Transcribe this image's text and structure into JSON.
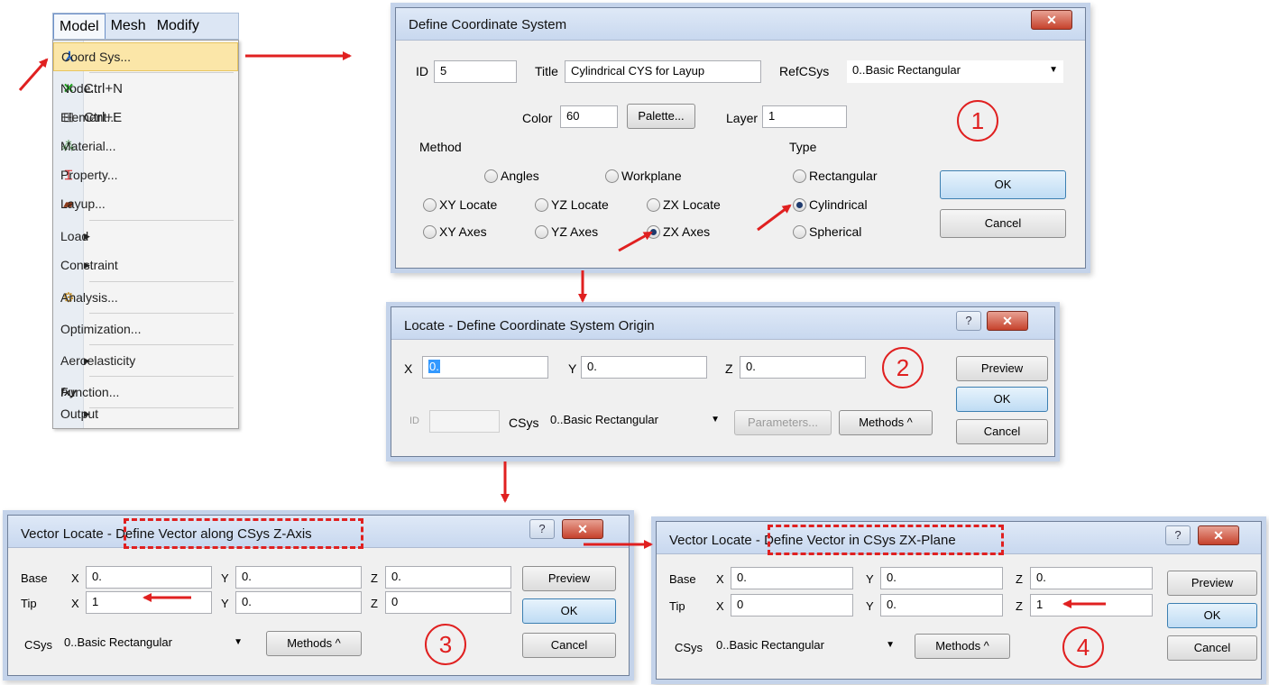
{
  "menubar": {
    "items": [
      "Model",
      "Mesh",
      "Modify"
    ]
  },
  "menu": {
    "items": [
      {
        "label": "Coord Sys...",
        "shortcut": "",
        "submenu": false,
        "icon": "⅄"
      },
      {
        "label": "Node...",
        "shortcut": "Ctrl+N",
        "submenu": false,
        "icon": "✕"
      },
      {
        "label": "Element...",
        "shortcut": "Ctrl+E",
        "submenu": false,
        "icon": "⊞"
      },
      {
        "label": "Material...",
        "shortcut": "",
        "submenu": false,
        "icon": "⁂"
      },
      {
        "label": "Property...",
        "shortcut": "",
        "submenu": false,
        "icon": "⌶"
      },
      {
        "label": "Layup...",
        "shortcut": "",
        "submenu": false,
        "icon": "▰"
      },
      {
        "label": "Load",
        "shortcut": "",
        "submenu": true,
        "icon": ""
      },
      {
        "label": "Constraint",
        "shortcut": "",
        "submenu": true,
        "icon": ""
      },
      {
        "label": "Analysis...",
        "shortcut": "",
        "submenu": false,
        "icon": "⚙"
      },
      {
        "label": "Optimization...",
        "shortcut": "",
        "submenu": false,
        "icon": ""
      },
      {
        "label": "Aeroelasticity",
        "shortcut": "",
        "submenu": true,
        "icon": ""
      },
      {
        "label": "Function...",
        "shortcut": "",
        "submenu": false,
        "icon": "fxy"
      },
      {
        "label": "Output",
        "shortcut": "",
        "submenu": true,
        "icon": ""
      }
    ]
  },
  "define_cs": {
    "title": "Define Coordinate System",
    "id_label": "ID",
    "id_value": "5",
    "title_label": "Title",
    "title_value": "Cylindrical CYS for Layup",
    "refcsys_label": "RefCSys",
    "refcsys_value": "0..Basic Rectangular",
    "color_label": "Color",
    "color_value": "60",
    "palette_label": "Palette...",
    "layer_label": "Layer",
    "layer_value": "1",
    "method_label": "Method",
    "type_label": "Type",
    "methods": [
      "Angles",
      "Workplane",
      "XY Locate",
      "YZ Locate",
      "ZX Locate",
      "XY Axes",
      "YZ Axes",
      "ZX Axes"
    ],
    "selected_method": "ZX Axes",
    "types": [
      "Rectangular",
      "Cylindrical",
      "Spherical"
    ],
    "selected_type": "Cylindrical",
    "ok_label": "OK",
    "cancel_label": "Cancel",
    "step": "1"
  },
  "locate": {
    "title": "Locate - Define Coordinate System Origin",
    "x_label": "X",
    "x_value": "0.",
    "y_label": "Y",
    "y_value": "0.",
    "z_label": "Z",
    "z_value": "0.",
    "id_label": "ID",
    "id_value": "",
    "csys_label": "CSys",
    "csys_value": "0..Basic Rectangular",
    "parameters_label": "Parameters...",
    "methods_label": "Methods ^",
    "preview_label": "Preview",
    "ok_label": "OK",
    "cancel_label": "Cancel",
    "step": "2"
  },
  "vector_z": {
    "title_prefix": "Vector Locate - ",
    "title_highlight": "Define Vector along CSys Z-Axis",
    "base_label": "Base",
    "tip_label": "Tip",
    "x_label": "X",
    "y_label": "Y",
    "z_label": "Z",
    "base": {
      "x": "0.",
      "y": "0.",
      "z": "0."
    },
    "tip": {
      "x": "1",
      "y": "0.",
      "z": "0"
    },
    "csys_label": "CSys",
    "csys_value": "0..Basic Rectangular",
    "methods_label": "Methods ^",
    "preview_label": "Preview",
    "ok_label": "OK",
    "cancel_label": "Cancel",
    "step": "3"
  },
  "vector_zx": {
    "title_prefix": "Vector Locate - ",
    "title_highlight": "Define Vector in CSys ZX-Plane",
    "base_label": "Base",
    "tip_label": "Tip",
    "x_label": "X",
    "y_label": "Y",
    "z_label": "Z",
    "base": {
      "x": "0.",
      "y": "0.",
      "z": "0."
    },
    "tip": {
      "x": "0",
      "y": "0.",
      "z": "1"
    },
    "csys_label": "CSys",
    "csys_value": "0..Basic Rectangular",
    "methods_label": "Methods ^",
    "preview_label": "Preview",
    "ok_label": "OK",
    "cancel_label": "Cancel",
    "step": "4"
  },
  "colors": {
    "annotation": "#e02020",
    "title_bar": "#c8d8ef",
    "dialog_bg": "#f0f0f0"
  }
}
